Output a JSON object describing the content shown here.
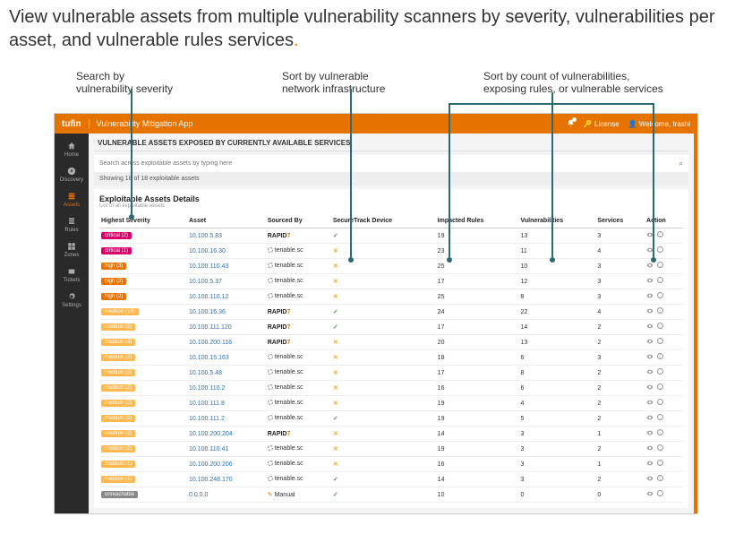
{
  "headline": "View vulnerable assets from multiple vulnerability scanners by severity, vulnerabilities per asset, and vulnerable rules services",
  "annotations": {
    "a1": "Search by\nvulnerability severity",
    "a2": "Sort by vulnerable\nnetwork infrastructure",
    "a3": "Sort by count of vulnerabilities,\nexposing rules, or vulnerable services"
  },
  "topbar": {
    "brand": "tufin",
    "app_name": "Vulnerability Mitigation App",
    "license": "License",
    "welcome": "Welcome, trashi"
  },
  "sidebar": [
    {
      "id": "home",
      "label": "Home"
    },
    {
      "id": "discovery",
      "label": "Discovery"
    },
    {
      "id": "assets",
      "label": "Assets",
      "active": true
    },
    {
      "id": "rules",
      "label": "Rules"
    },
    {
      "id": "zones",
      "label": "Zones"
    },
    {
      "id": "tickets",
      "label": "Tickets"
    },
    {
      "id": "settings",
      "label": "Settings"
    }
  ],
  "page": {
    "heading": "VULNERABLE ASSETS EXPOSED BY CURRENTLY AVAILABLE SERVICES",
    "search_placeholder": "Search across exploitable assets by typing here",
    "showing": "Showing 18 of 18 exploitable assets",
    "details_title": "Exploitable Assets Details",
    "details_sub": "List of all exploitable assets"
  },
  "columns": {
    "severity": "Highest Severity",
    "asset": "Asset",
    "source": "Sourced By",
    "device": "SecureTrack Device",
    "rules": "Impacted Rules",
    "vulns": "Vulnerabilities",
    "services": "Services",
    "action": "Action"
  },
  "sources": {
    "rapid7": "RAPID7",
    "tenable": "tenable.sc",
    "manual": "Manual"
  },
  "severity_labels": {
    "critical": "critical (2)",
    "critical1": "critical (1)",
    "high3": "high (3)",
    "high2": "high (2)",
    "medium10": "medium (10)",
    "medium5": "medium (5)",
    "medium4": "medium (4)",
    "medium2": "medium (2)",
    "medium1": "medium (1)",
    "unreachable": "unreachable"
  },
  "rows": [
    {
      "sev": "critical",
      "sev_key": "critical",
      "asset": "10.100.5.83",
      "src": "rapid7",
      "device": "check",
      "rules": 19,
      "vulns": 13,
      "services": 3
    },
    {
      "sev": "critical",
      "sev_key": "critical1",
      "asset": "10.100.16.30",
      "src": "tenable",
      "device": "x",
      "rules": 23,
      "vulns": 11,
      "services": 4
    },
    {
      "sev": "high",
      "sev_key": "high3",
      "asset": "10.100.110.43",
      "src": "tenable",
      "device": "x",
      "rules": 25,
      "vulns": 10,
      "services": 3
    },
    {
      "sev": "high",
      "sev_key": "high2",
      "asset": "10.100.5.37",
      "src": "tenable",
      "device": "x",
      "rules": 17,
      "vulns": 12,
      "services": 3
    },
    {
      "sev": "high",
      "sev_key": "high2",
      "asset": "10.100.110.12",
      "src": "tenable",
      "device": "x",
      "rules": 25,
      "vulns": 8,
      "services": 3
    },
    {
      "sev": "medium",
      "sev_key": "medium10",
      "asset": "10.100.16.36",
      "src": "rapid7",
      "device": "check",
      "rules": 24,
      "vulns": 22,
      "services": 4
    },
    {
      "sev": "medium",
      "sev_key": "medium5",
      "asset": "10.100.111.120",
      "src": "rapid7",
      "device": "check",
      "rules": 17,
      "vulns": 14,
      "services": 2
    },
    {
      "sev": "medium",
      "sev_key": "medium4",
      "asset": "10.100.200.116",
      "src": "rapid7",
      "device": "x",
      "rules": 20,
      "vulns": 13,
      "services": 2
    },
    {
      "sev": "medium",
      "sev_key": "medium2",
      "asset": "10.100.15.163",
      "src": "tenable",
      "device": "x",
      "rules": 18,
      "vulns": 6,
      "services": 3
    },
    {
      "sev": "medium",
      "sev_key": "medium2",
      "asset": "10.100.5.48",
      "src": "tenable",
      "device": "x",
      "rules": 17,
      "vulns": 8,
      "services": 2
    },
    {
      "sev": "medium",
      "sev_key": "medium2",
      "asset": "10.100.110.2",
      "src": "tenable",
      "device": "x",
      "rules": 16,
      "vulns": 6,
      "services": 2
    },
    {
      "sev": "medium",
      "sev_key": "medium2",
      "asset": "10.100.111.8",
      "src": "tenable",
      "device": "x",
      "rules": 19,
      "vulns": 4,
      "services": 2
    },
    {
      "sev": "medium",
      "sev_key": "medium2",
      "asset": "10.100.111.2",
      "src": "tenable",
      "device": "check",
      "rules": 19,
      "vulns": 5,
      "services": 2
    },
    {
      "sev": "medium",
      "sev_key": "medium2",
      "asset": "10.100.200.204",
      "src": "rapid7",
      "device": "x",
      "rules": 14,
      "vulns": 3,
      "services": 1
    },
    {
      "sev": "medium",
      "sev_key": "medium2",
      "asset": "10.100.110.41",
      "src": "tenable",
      "device": "x",
      "rules": 19,
      "vulns": 3,
      "services": 2
    },
    {
      "sev": "medium",
      "sev_key": "medium1",
      "asset": "10.100.200.206",
      "src": "tenable",
      "device": "x",
      "rules": 16,
      "vulns": 3,
      "services": 1
    },
    {
      "sev": "medium",
      "sev_key": "medium1",
      "asset": "10.100.248.170",
      "src": "tenable",
      "device": "check",
      "rules": 14,
      "vulns": 3,
      "services": 2
    },
    {
      "sev": "unreachable",
      "sev_key": "unreachable",
      "asset": "0.0.0.0",
      "src": "manual",
      "device": "check",
      "rules": 10,
      "vulns": 0,
      "services": 0
    }
  ]
}
